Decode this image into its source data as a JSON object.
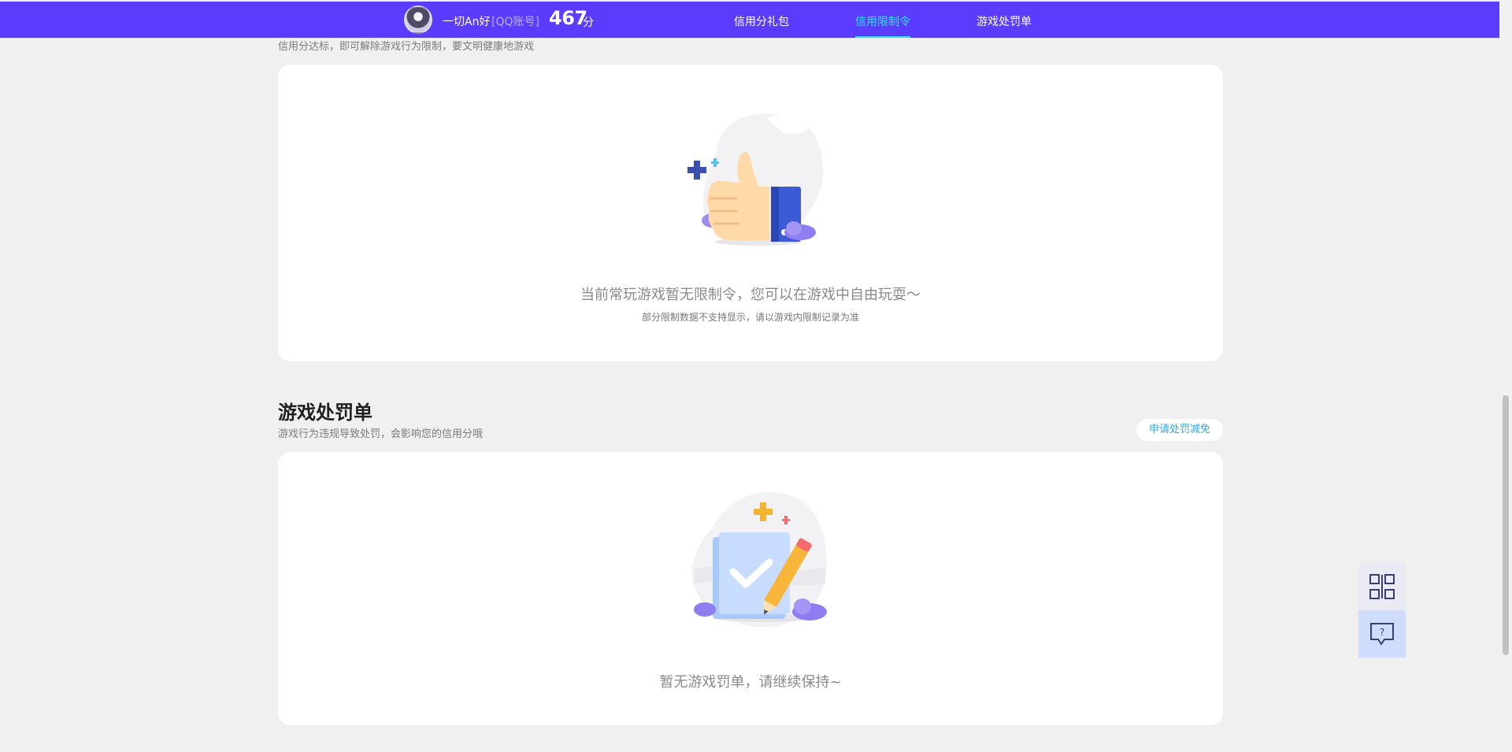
{
  "header": {
    "nickname": "一切An好",
    "account_type": "[QQ账号]",
    "score": "467",
    "score_unit": "分",
    "nav": [
      {
        "label": "信用分礼包",
        "active": false
      },
      {
        "label": "信用限制令",
        "active": true
      },
      {
        "label": "游戏处罚单",
        "active": false
      }
    ],
    "accent_color": "#5b3cff",
    "active_color": "#31e2ff"
  },
  "restriction": {
    "subtitle": "信用分达标，即可解除游戏行为限制，要文明健康地游戏",
    "empty_main": "当前常玩游戏暂无限制令，您可以在游戏中自由玩耍～",
    "empty_note": "部分限制数据不支持显示，请以游戏内限制记录为准"
  },
  "penalty": {
    "title": "游戏处罚单",
    "subtitle": "游戏行为违规导致处罚，会影响您的信用分哦",
    "apply_button": "申请处罚减免",
    "empty_main": "暂无游戏罚单，请继续保持~"
  },
  "float_buttons": [
    {
      "icon": "qr-code-icon"
    },
    {
      "icon": "help-chat-icon"
    }
  ]
}
